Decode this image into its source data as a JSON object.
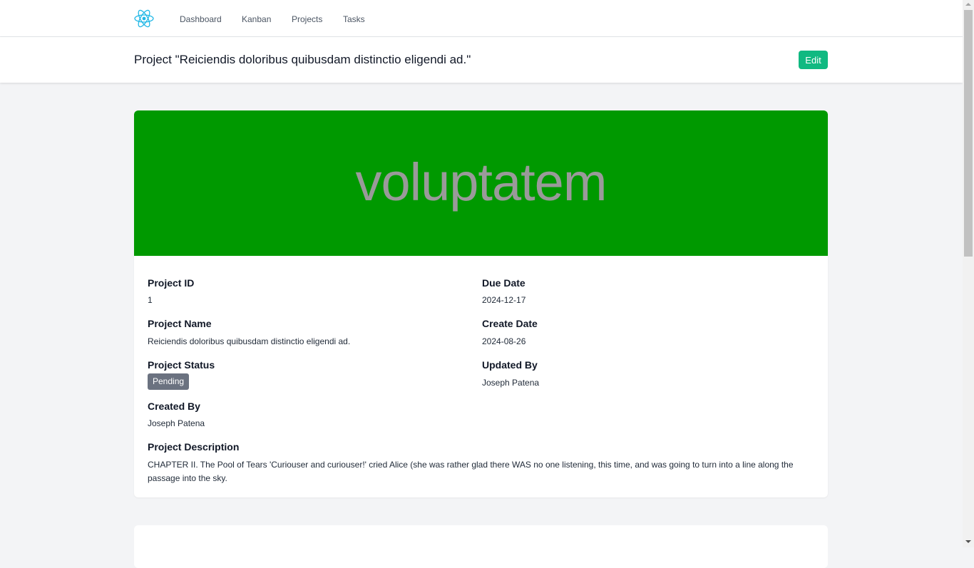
{
  "nav": {
    "logo_icon": "react-atom-icon",
    "links": [
      "Dashboard",
      "Kanban",
      "Projects",
      "Tasks"
    ]
  },
  "header": {
    "title": "Project \"Reiciendis doloribus quibusdam distinctio eligendi ad.\"",
    "edit_label": "Edit"
  },
  "banner": {
    "text": "voluptatem",
    "background_color": "#009900"
  },
  "details": {
    "project_id_label": "Project ID",
    "project_id": "1",
    "due_date_label": "Due Date",
    "due_date": "2024-12-17",
    "project_name_label": "Project Name",
    "project_name": "Reiciendis doloribus quibusdam distinctio eligendi ad.",
    "create_date_label": "Create Date",
    "create_date": "2024-08-26",
    "status_label": "Project Status",
    "status": "Pending",
    "updated_by_label": "Updated By",
    "updated_by": "Joseph Patena",
    "created_by_label": "Created By",
    "created_by": "Joseph Patena",
    "description_label": "Project Description",
    "description": "CHAPTER II. The Pool of Tears 'Curiouser and curiouser!' cried Alice (she was rather glad there WAS no one listening, this time, and was going to turn into a line along the passage into the sky."
  },
  "colors": {
    "accent": "#10b981",
    "status_badge": "#6b7280",
    "logo": "#61dafb"
  }
}
